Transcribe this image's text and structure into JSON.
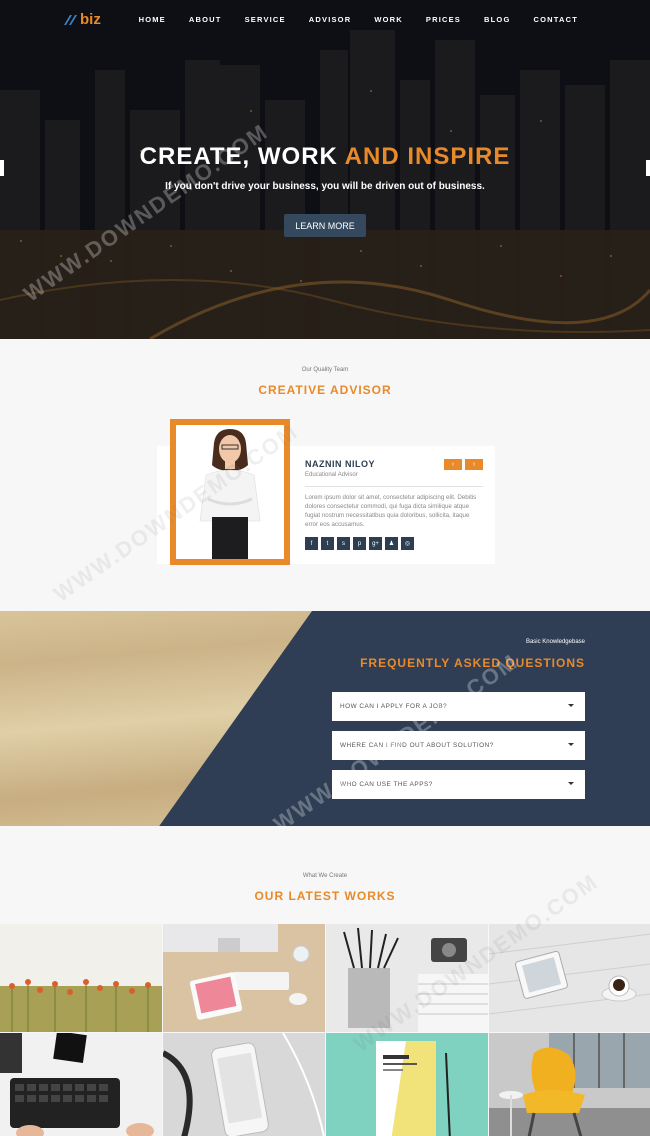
{
  "brand": {
    "logo_text": "biz",
    "accent": "#e98a2a",
    "navy": "#2f3e54"
  },
  "nav": {
    "items": [
      "HOME",
      "ABOUT",
      "SERVICE",
      "ADVISOR",
      "WORK",
      "PRICES",
      "BLOG",
      "CONTACT"
    ]
  },
  "hero": {
    "title_main": "CREATE, WORK ",
    "title_accent": "AND INSPIRE",
    "subtitle": "If you don't drive your business, you will be driven out of business.",
    "button": "LEARN MORE"
  },
  "advisor": {
    "kicker": "Our Quality Team",
    "title": "CREATIVE ADVISOR",
    "name": "NAZNIN NILOY",
    "role": "Educational Advisor",
    "bio": "Lorem ipsum dolor sit amet, consectetur adipiscing elit. Debitis dolores consectetur commodi, qui fuga dicta similique atque fugiat nostrum necessitatibus quia doloribus, sollicita, itaque error eos accusamus.",
    "prev_icon": "‹",
    "next_icon": "›",
    "socials": [
      {
        "icon": "facebook-icon",
        "glyph": "f"
      },
      {
        "icon": "twitter-icon",
        "glyph": "t"
      },
      {
        "icon": "skype-icon",
        "glyph": "s"
      },
      {
        "icon": "pinterest-icon",
        "glyph": "p"
      },
      {
        "icon": "google-plus-icon",
        "glyph": "g+"
      },
      {
        "icon": "github-icon",
        "glyph": "♟"
      },
      {
        "icon": "dribbble-icon",
        "glyph": "◎"
      }
    ]
  },
  "faq": {
    "kicker": "Basic Knowledgebase",
    "title": "FREQUENTLY ASKED QUESTIONS",
    "items": [
      "HOW CAN I APPLY FOR A JOB?",
      "WHERE CAN I FIND OUT ABOUT SOLUTION?",
      "WHO CAN USE THE APPS?"
    ]
  },
  "works": {
    "kicker": "What We Create",
    "title": "OUR LATEST WORKS",
    "items": [
      "flowers-field",
      "workspace-imac",
      "pencil-cup",
      "tablet-coffee",
      "keyboard-desk",
      "smartphone-white",
      "a4-paper-mockup",
      "yellow-chair"
    ]
  },
  "watermark": "WWW.DOWNDEMO.COM"
}
